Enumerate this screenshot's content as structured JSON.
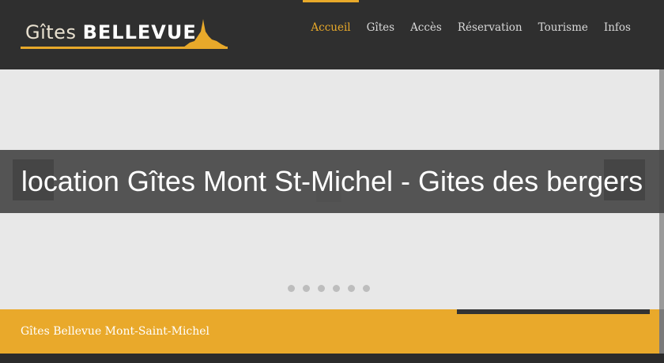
{
  "header": {
    "logo_light": "Gîtes",
    "logo_bold": "BELLEVUE",
    "nav": [
      {
        "label": "Accueil",
        "active": true
      },
      {
        "label": "Gîtes",
        "active": false
      },
      {
        "label": "Accès",
        "active": false
      },
      {
        "label": "Réservation",
        "active": false
      },
      {
        "label": "Tourisme",
        "active": false
      },
      {
        "label": "Infos",
        "active": false
      }
    ]
  },
  "slider": {
    "prev_icon": "‹",
    "next_icon": "›",
    "dot_count": 6
  },
  "overlay": {
    "title": "location Gîtes Mont St-Michel - Gites des bergers"
  },
  "footer": {
    "text": "Gîtes Bellevue Mont-Saint-Michel"
  },
  "colors": {
    "accent": "#e8a92a",
    "header_bg": "#2f2f2f",
    "slider_bg": "#e8e8e8"
  }
}
